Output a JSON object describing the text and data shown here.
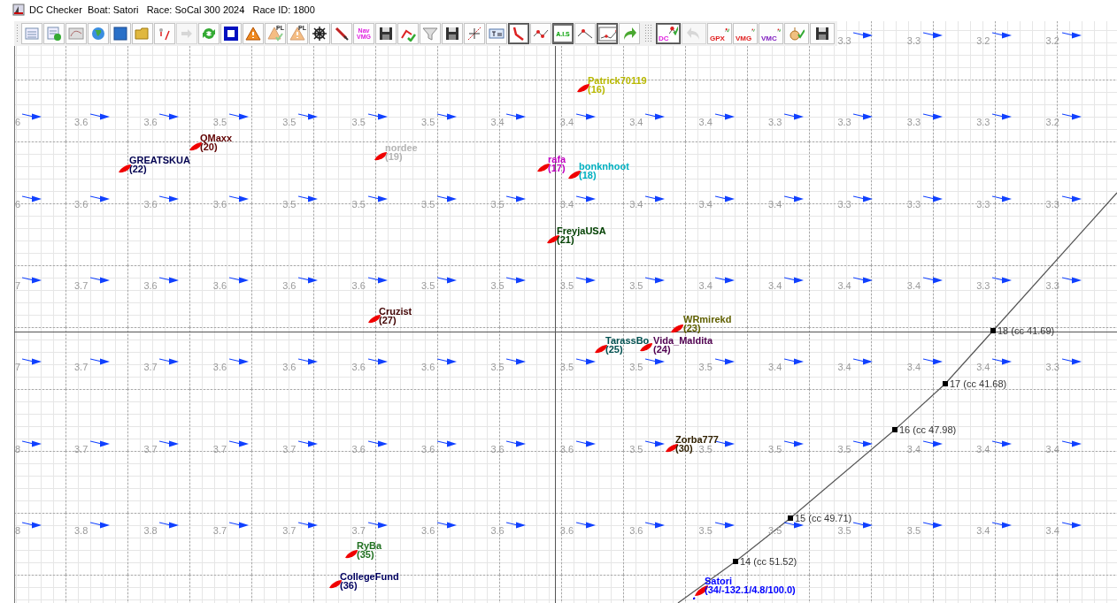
{
  "window": {
    "title": "DC Checker  Boat: Satori   Race: SoCal 300 2024   Race ID: 1800"
  },
  "toolbar": {
    "groups": [
      [
        {
          "kind": "list",
          "pressed": false,
          "disabled": false
        },
        {
          "kind": "table-add",
          "pressed": false,
          "disabled": false
        },
        {
          "kind": "map",
          "pressed": false,
          "disabled": false
        },
        {
          "kind": "globe",
          "pressed": false,
          "disabled": false
        },
        {
          "kind": "square",
          "pressed": false,
          "disabled": false
        },
        {
          "kind": "folder",
          "pressed": false,
          "disabled": false
        },
        {
          "kind": "route-marks",
          "pressed": false,
          "disabled": false
        },
        {
          "kind": "arrow-right",
          "pressed": false,
          "disabled": true
        },
        {
          "kind": "refresh",
          "pressed": false,
          "disabled": false
        },
        {
          "kind": "framed-square",
          "pressed": false,
          "disabled": false
        },
        {
          "kind": "warning",
          "pressed": false,
          "disabled": false
        },
        {
          "kind": "warning-check",
          "label": "PL",
          "pressed": false,
          "disabled": false
        },
        {
          "kind": "warning",
          "label": "PL",
          "pressed": false,
          "disabled": false
        },
        {
          "kind": "helm",
          "pressed": false,
          "disabled": false
        },
        {
          "kind": "screwdriver",
          "pressed": false,
          "disabled": false
        },
        {
          "kind": "tag",
          "label": "Nav VMG",
          "pressed": false,
          "disabled": false
        },
        {
          "kind": "save",
          "pressed": false,
          "disabled": false
        },
        {
          "kind": "route-check",
          "pressed": false,
          "disabled": false
        },
        {
          "kind": "funnel",
          "pressed": false,
          "disabled": false
        },
        {
          "kind": "save",
          "pressed": false,
          "disabled": false
        },
        {
          "kind": "crosshair",
          "pressed": false,
          "disabled": false
        },
        {
          "kind": "text-field",
          "pressed": false,
          "disabled": false
        },
        {
          "kind": "route",
          "pressed": true,
          "disabled": false
        },
        {
          "kind": "zigzag",
          "pressed": false,
          "disabled": false
        },
        {
          "kind": "tag",
          "label": "A.I.S",
          "pressed": true,
          "disabled": false
        },
        {
          "kind": "polyline",
          "pressed": false,
          "disabled": false
        },
        {
          "kind": "chart",
          "pressed": true,
          "disabled": false
        },
        {
          "kind": "redo",
          "pressed": false,
          "disabled": false
        }
      ],
      [
        {
          "kind": "route-text",
          "label": "DC",
          "pressed": true,
          "disabled": false
        },
        {
          "kind": "undo",
          "pressed": false,
          "disabled": true
        },
        {
          "kind": "route-text",
          "label": "GPX",
          "pressed": false,
          "disabled": false
        },
        {
          "kind": "route-text",
          "label": "VMG",
          "pressed": false,
          "disabled": false
        },
        {
          "kind": "route-text",
          "label": "VMC",
          "pressed": false,
          "disabled": false
        },
        {
          "kind": "compass-check",
          "pressed": false,
          "disabled": false
        },
        {
          "kind": "save",
          "pressed": false,
          "disabled": false
        }
      ]
    ]
  },
  "map": {
    "wind_rows": [
      [
        null,
        null,
        null,
        null,
        null,
        null,
        null,
        null,
        null,
        null,
        null,
        null,
        "3.3",
        "3.3",
        "3.2",
        "3.2"
      ],
      [
        "6",
        "3.6",
        "3.6",
        "3.5",
        "3.5",
        "3.5",
        "3.5",
        "3.4",
        "3.4",
        "3.4",
        "3.4",
        "3.3",
        "3.3",
        "3.3",
        "3.3",
        "3.2"
      ],
      [
        "6",
        "3.6",
        "3.6",
        "3.6",
        "3.5",
        "3.5",
        "3.5",
        "3.5",
        "3.4",
        "3.4",
        "3.4",
        "3.4",
        "3.3",
        "3.3",
        "3.3",
        "3.3"
      ],
      [
        "7",
        "3.7",
        "3.6",
        "3.6",
        "3.6",
        "3.6",
        "3.5",
        "3.5",
        "3.5",
        "3.5",
        "3.4",
        "3.4",
        "3.4",
        "3.4",
        "3.3",
        "3.3"
      ],
      [
        "7",
        "3.7",
        "3.7",
        "3.6",
        "3.6",
        "3.6",
        "3.6",
        "3.5",
        "3.5",
        "3.5",
        "3.5",
        "3.4",
        "3.4",
        "3.4",
        "3.4",
        "3.3"
      ],
      [
        "8",
        "3.7",
        "3.7",
        "3.7",
        "3.7",
        "3.6",
        "3.6",
        "3.6",
        "3.6",
        "3.5",
        "3.5",
        "3.5",
        "3.5",
        "3.4",
        "3.4",
        "3.4"
      ],
      [
        "8",
        "3.8",
        "3.8",
        "3.7",
        "3.7",
        "3.7",
        "3.6",
        "3.6",
        "3.6",
        "3.6",
        "3.5",
        "3.5",
        "3.5",
        "3.5",
        "3.4",
        "3.4"
      ]
    ],
    "boats": [
      {
        "name": "Patrick70119",
        "number": "(16)",
        "color": "#b8b800"
      },
      {
        "name": "QMaxx",
        "number": "(20)",
        "color": "#600000"
      },
      {
        "name": "GREATSKUA",
        "number": "(22)",
        "color": "#000050"
      },
      {
        "name": "nordee",
        "number": "(19)",
        "color": "#b4b4b4"
      },
      {
        "name": "rafa",
        "number": "(17)",
        "color": "#c000c0"
      },
      {
        "name": "bonknhoot",
        "number": "(18)",
        "color": "#00b0c0"
      },
      {
        "name": "FreyjaUSA",
        "number": "(21)",
        "color": "#004000"
      },
      {
        "name": "Cruzist",
        "number": "(27)",
        "color": "#400000"
      },
      {
        "name": "TarassBo",
        "number": "(25)",
        "color": "#005050"
      },
      {
        "name": "WRmirekd",
        "number": "(23)",
        "color": "#606000"
      },
      {
        "name": "Vida_Maldita",
        "number": "(24)",
        "color": "#500050"
      },
      {
        "name": "Zorba777",
        "number": "(30)",
        "color": "#302000"
      },
      {
        "name": "RyBa",
        "number": "(35)",
        "color": "#207020"
      },
      {
        "name": "CollegeFund",
        "number": "(36)",
        "color": "#000060"
      },
      {
        "name": "Satori",
        "number": "(34/-132.1/4.8/100.0)",
        "color": "#0000ff"
      }
    ],
    "track_points": [
      {
        "label": "18 (cc 41.69)"
      },
      {
        "label": "17 (cc 41.68)"
      },
      {
        "label": "16 (cc 47.98)"
      },
      {
        "label": "15 (cc 49.71)"
      },
      {
        "label": "14 (cc 51.52)"
      }
    ]
  }
}
